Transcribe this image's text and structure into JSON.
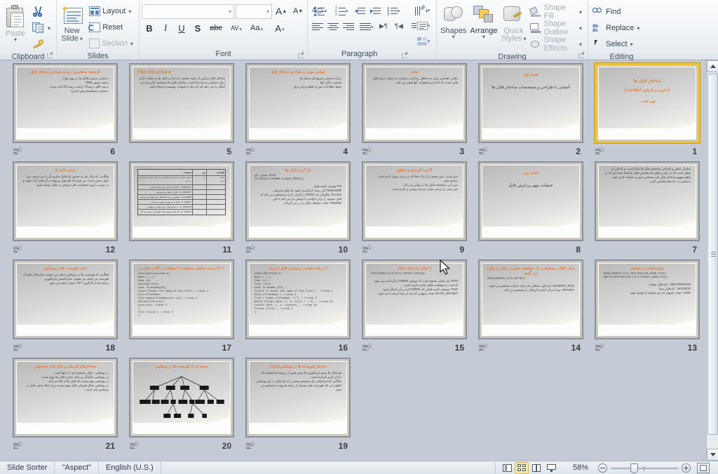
{
  "app": {
    "view_name": "Slide Sorter",
    "theme_name": "\"Aspect\"",
    "language": "English (U.S.)",
    "zoom_level": "58%",
    "accent_title_color": "#e8732a",
    "selection_color": "#f0c230"
  },
  "ribbon": {
    "groups": [
      {
        "name": "Clipboard",
        "label": "Clipboard"
      },
      {
        "name": "Slides",
        "label": "Slides"
      },
      {
        "name": "Font",
        "label": "Font"
      },
      {
        "name": "Paragraph",
        "label": "Paragraph"
      },
      {
        "name": "Drawing",
        "label": "Drawing"
      },
      {
        "name": "Editing",
        "label": "Editing"
      }
    ],
    "clipboard": {
      "paste_label": "Paste",
      "cut_tooltip": "Cut",
      "copy_tooltip": "Copy",
      "format_painter_tooltip": "Format Painter"
    },
    "slides": {
      "new_slide_label": "New\nSlide",
      "new_slide_line1": "New",
      "new_slide_line2": "Slide",
      "layout_label": "Layout",
      "reset_label": "Reset",
      "section_label": "Section"
    },
    "font": {
      "font_name_value": "",
      "font_size_value": "",
      "grow_font": "A",
      "shrink_font": "A",
      "clear_formatting": "Aa",
      "bold": "B",
      "italic": "I",
      "underline": "U",
      "shadow": "S",
      "strikethrough": "abc",
      "char_spacing": "AV",
      "change_case": "Aa",
      "font_color": "A"
    },
    "drawing": {
      "shapes_label": "Shapes",
      "arrange_label": "Arrange",
      "quick_styles_line1": "Quick",
      "quick_styles_line2": "Styles",
      "shape_fill_label": "Shape Fill",
      "shape_outline_label": "Shape Outline",
      "shape_effects_label": "Shape Effects"
    },
    "editing": {
      "find_label": "Find",
      "replace_label": "Replace",
      "select_label": "Select"
    }
  },
  "slides": [
    {
      "number": "6",
      "selected": false,
      "has_animation": true,
      "title": "تاریخچه مختصری درباره طراحی ساختار فایل",
      "body": "دستیابی ترتیبی (فایل ها بر روی نوار)\nدرصد دومین 1950\nدرصد 60و درصد70 ترکیب درصد 40 ثابت بودند\nدستیابی مستقیم(درهم سازی)"
    },
    {
      "number": "5",
      "selected": false,
      "has_animation": false,
      "title": "File Structure",
      "title_english": true,
      "body": "ساختار فایل ترکیبی از نحوه نمایش داده ها در فایل ها و عملیات لازم برای دستیابی به داده ها است. ساختار فایل ها مشخصه کاربردی این امکان را می دهد که داده ها را بخوانند، بنویسند و اصلاح کنند."
    },
    {
      "number": "4",
      "selected": false,
      "has_animation": true,
      "title": "عوامل موثر در طراحی ساختار فایل",
      "body": "زمان دستیابی سریع کم دیسک ها\nظرفیت بالای آنها\nحفظ اطلاعات پس از قطع جریان برق"
    },
    {
      "number": "3",
      "selected": false,
      "has_animation": true,
      "title": "هدف",
      "body": "یافتن راهنمایی برای به حداقل رساندن دستیابی به دیسک، برای فایل هایی است که اندازه و محتویات آنها تغییر می کند."
    },
    {
      "number": "2",
      "selected": false,
      "has_animation": true,
      "title": "فصل اول",
      "subtitle": "آشنایی با طراحی و مشخصات ساختار فایل ها",
      "is_section": true
    },
    {
      "number": "1",
      "selected": true,
      "has_animation": true,
      "title": "ساختار فایل ها",
      "subtitle2": "(ذخیره و بازیابی اطلاعات)",
      "subtitle3": ": تهیه کننده",
      "is_title_slide": true
    },
    {
      "number": "12",
      "selected": false,
      "has_animation": true,
      "title": "بستن فایل ها",
      "body": "هنگامی که دیگر نیاز به حضور یک فایل نداریم آن را می بندیم، زیرا عمل بستن باعث می شود که بافرهای مربوط به آن فایل آزاد شوند و در صورت لزوم محتویات بافر خروجی در فایل نوشته شود."
    },
    {
      "number": "11",
      "selected": false,
      "has_animation": false,
      "is_table": true,
      "table": {
        "headers": [
          "توضیحات",
          "نوع",
          "نگهدارنده"
        ],
        "rows": [
          [
            "خاصیت بازگشت یا بازیابی یک ساختار داده یا بیشتر خاصی تبدیل احتیاج می کند.",
            "نام",
            "مقدار\nخاص"
          ],
          [
            "O_RDONLY : آمادگی حاصل برای خواندن فایل",
            "",
            ""
          ],
          [
            "O_WRONLY : فایل را فقط برای نوشتن",
            "",
            ""
          ],
          [
            "O_RDWR : مشخص می کند که فایل برای خواندن و نوشتن باز می شود.",
            "",
            ""
          ],
          [
            "O_CREAT : فایل را در صورت نبودن می سازد",
            "",
            ""
          ],
          [
            "O_APPEND : به فرض فایل برای خواندن و نوشتن",
            "",
            ""
          ],
          [
            "O_TRUNC : اگر فایل موجود باشد طول آن را صفر می کند",
            "",
            ""
          ]
        ]
      }
    },
    {
      "number": "10",
      "selected": false,
      "has_animation": true,
      "title": "باز کردن فایل ها",
      "code": "معرفی تابع OPEN\nFD=OPEN(FILENAME,FLAGS[,PMODE])",
      "body": "FD توصیف کننده فایل.\nFILENAME یک رشته کاراکتری حاوی نام فایل فیزیکی.\nFLAGS: چگونگی باز OPEN را کنترل کرده و مشخص می کند که فایل موجود را برای خواندن یا نوشتن باز می کند یا خیر.\nPMODE: حالت حفاظت فایل را بر می گرداند."
    },
    {
      "number": "9",
      "selected": false,
      "has_animation": true,
      "title": "کاربرد قرمزی و منظور",
      "body": "متن قرمز: متن حجیم تر از یک خط که در برخی موارد لازم است ترجمه شود.\nمتن آبی: مشخصه فایل ها را روشن می کند.\nمتن سبز: در برخی موارد ترجمه روشن تر لازم است."
    },
    {
      "number": "8",
      "selected": false,
      "has_animation": false,
      "title": "فصل دوم",
      "subtitle": "عملیات مهم پردازش فایل",
      "is_section": true
    },
    {
      "number": "7",
      "selected": false,
      "has_animation": false,
      "body": "نمایش عملی و طراحی مشخص فایل ها مبنا است، بر اساس آن شکل است که به زبان و فایل ها مشخص فایل ها آشنا شده ایم که در واقع مفهوم ساختار فایل باید مشخص شود و عملیات لازم جهت دستیابی به داده ها مشخص گردد."
    },
    {
      "number": "18",
      "selected": false,
      "has_animation": true,
      "title": "حذف فهرست ها در یونیکس",
      "body": "هنگامی که فهرست ها در یونیکس حذف می شوند، تمام فایل های آن فهرست نیز حذف می شوند. سازماندهی دایرکتوری.\nبرنامه ها به کارگیری \"rm\" عملی حذف می شود."
    },
    {
      "number": "17",
      "selected": false,
      "has_animation": false,
      "title": "برنامه نمایش محتویات با استفاده از کلاس فایل در C++",
      "code": "#include<iostream.h>\nmain ( ) {\nchar ch;\nfstream file;\nchar filename[20];\ncout<<\"enter the name of the file\";   //step 1\ncin>>filename;\nfile.open(filename,ios::in);   //step 2\nwhile(file>>ch){\n  cout<<ch;   //step 3\n}\nfile.close();   //step 4\n}"
    },
    {
      "number": "16",
      "selected": false,
      "has_animation": false,
      "title": "برنامه خواندن و نوشتن فایل به زبان C",
      "code": "#INCLUDE<STDIO.H>\nMain ( ) {\nChar ch ;\nFILE *file ;\nChar filename [20] ;\nPrintf (\" enter the name of the file\") ;   //step 1\nGets (filename) ;   //step 2\nFile = fopen (filename, \"r\") ;   //step 3\nWhile (fread (&ch, 1, 1, file) ! = 0) ;   //step 4a\n   Fwrite (&ch, 1, 1, student) ;   //step 4b\nFclose (file) ;   //step 5\n}"
    },
    {
      "number": "15",
      "selected": false,
      "has_animation": true,
      "title": "پیگرد یا حرکت فایل C",
      "code": "POS=FSEEK(FILE,BYTE_OFFSET,ORIGIN)",
      "body": "POS: یک مقدار صحیح است که موجود FSEEK برگردانده می شود که بایت را موقعیت فعلی اشاره کرده است.\nFILE: توصیف کننده فایلی که FSEEK باید بر آن اعمال شود.\nBYTE_OFFSET: تعداد بایتهایی که باید از مبدا حرکت داده شود."
    },
    {
      "number": "14",
      "selected": false,
      "has_animation": true,
      "title": "عمل انتقال مستقیم به یک موقعیت معین در فایل را پیگرد می گویند",
      "code": "SEEK(SOURCE_FILE,OFFSET)",
      "body": "SOURCE_FILE: نام فایل منطقی که مرک حرکت جستجو می شود.\nOFFSET: مبدا حرکت اشاره کرفایل را مشخص می کند."
    },
    {
      "number": "13",
      "selected": false,
      "has_animation": true,
      "title": "توابع خواندن و نوشتن",
      "code": "READ(SOURCE_FILE,DESTINATION_ADDR,SIZE)\nWRITE(DESTINATION_FILE,SOURCE_ADDR,SIZE)",
      "body": "DESTINATION : نام فایل مقصد\nSOURCE : نام فایل مبدا\nSIZE : تعداد بایتهای که باید خوانده یا نوشته شود"
    },
    {
      "number": "21",
      "selected": false,
      "has_animation": true,
      "title": "ساختارهای فیزیکی و فایل های مخصوص",
      "body": "در یونیکس ، فایل مجموعه ای از بایتها است\nدر یونیکس، چگونگی و محل ذخیره فایل ها مهم نیست\nدر یونیکس مهم نیست که فایل ها از کجا می آیند\nدر یونیکس شکل فیزیکی فایل مهم نیست زیرا عملا مخفی فایل در یونیکس یکی است."
    },
    {
      "number": "20",
      "selected": false,
      "has_animation": true,
      "title": "نمونه ای از فهرست ها در یونیکس",
      "is_tree": true
    },
    {
      "number": "19",
      "selected": false,
      "has_animation": true,
      "title": "ساختار فهرست ها در یونیکس(ادامه)",
      "body": "هم فایل ها و هم دایرکتوری ها چنین همین از پرونده ها هستند که دارای نام و شماره است.\nهنگامی که فراخوانی یک سیستم مسیر را به یک فایل در این یونیکس اظهار می کند فهرست های موجود از ریشه شروع به جستجو می شود."
    }
  ],
  "scrollbar": {
    "name": "vertical-scrollbar"
  }
}
